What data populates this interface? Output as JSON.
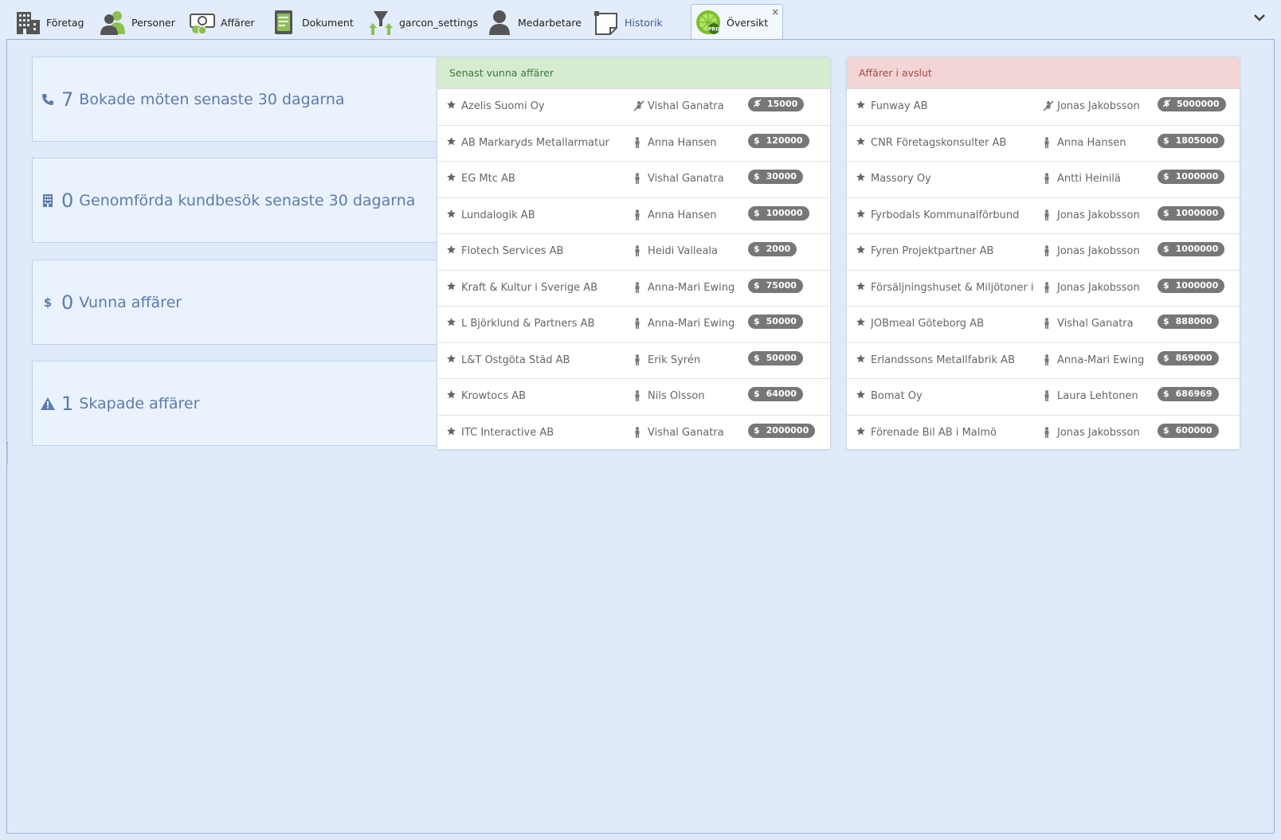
{
  "tabs": [
    {
      "label": "Företag",
      "icon": "building-icon"
    },
    {
      "label": "Personer",
      "icon": "people-icon"
    },
    {
      "label": "Affärer",
      "icon": "money-icon"
    },
    {
      "label": "Dokument",
      "icon": "document-icon"
    },
    {
      "label": "garcon_settings",
      "icon": "funnel-icon"
    },
    {
      "label": "Medarbetare",
      "icon": "person-icon"
    },
    {
      "label": "Historik",
      "icon": "note-icon"
    },
    {
      "label": "Översikt",
      "icon": "lime-pro-icon",
      "close": "×"
    }
  ],
  "stats": [
    {
      "count": "7",
      "text": "Bokade möten senaste 30 dagarna",
      "icon": "phone-icon"
    },
    {
      "count": "0",
      "text": "Genomförda kundbesök senaste 30 dagarna",
      "icon": "building-small-icon"
    },
    {
      "count": "0",
      "text": "Vunna affärer",
      "icon": "dollar-icon"
    },
    {
      "count": "1",
      "text": "Skapade affärer",
      "icon": "warning-icon"
    }
  ],
  "won": {
    "title": "Senast vunna affärer",
    "rows": [
      {
        "company": "Azelis Suomi Oy",
        "person": "Vishal Ganatra",
        "person_icon": "user-off-icon",
        "currency": "$",
        "value": "15000"
      },
      {
        "company": "AB Markaryds Metallarmatur",
        "person": "Anna Hansen",
        "person_icon": "person-icon",
        "currency": "$",
        "value": "120000"
      },
      {
        "company": "EG Mtc AB",
        "person": "Vishal Ganatra",
        "person_icon": "person-icon",
        "currency": "$",
        "value": "30000"
      },
      {
        "company": "Lundalogik AB",
        "person": "Anna Hansen",
        "person_icon": "person-icon",
        "currency": "$",
        "value": "100000"
      },
      {
        "company": "Flotech Services AB",
        "person": "Heidi Valleala",
        "person_icon": "person-icon",
        "currency": "$",
        "value": "2000"
      },
      {
        "company": "Kraft & Kultur i Sverige AB",
        "person": "Anna-Mari Ewing",
        "person_icon": "person-icon",
        "currency": "$",
        "value": "75000"
      },
      {
        "company": "L Björklund & Partners AB",
        "person": "Anna-Mari Ewing",
        "person_icon": "person-icon",
        "currency": "$",
        "value": "50000"
      },
      {
        "company": "L&T Östgöta Städ AB",
        "person": "Erik Syrén",
        "person_icon": "person-icon",
        "currency": "$",
        "value": "50000"
      },
      {
        "company": "Krowtocs AB",
        "person": "Nils Olsson",
        "person_icon": "person-icon",
        "currency": "$",
        "value": "64000"
      },
      {
        "company": "ITC Interactive AB",
        "person": "Vishal Ganatra",
        "person_icon": "person-icon",
        "currency": "$",
        "value": "2000000"
      }
    ]
  },
  "closing": {
    "title": "Affärer i avslut",
    "rows": [
      {
        "company": "Funway AB",
        "person": "Jonas Jakobsson",
        "person_icon": "user-off-icon",
        "currency": "$",
        "value": "5000000"
      },
      {
        "company": "CNR Företagskonsulter AB",
        "person": "Anna Hansen",
        "person_icon": "person-icon",
        "currency": "$",
        "value": "1805000"
      },
      {
        "company": "Massory Oy",
        "person": "Antti Heinilä",
        "person_icon": "person-icon",
        "currency": "$",
        "value": "1000000"
      },
      {
        "company": "Fyrbodals Kommunalförbund",
        "person": "Jonas Jakobsson",
        "person_icon": "person-icon",
        "currency": "$",
        "value": "1000000"
      },
      {
        "company": "Fyren Projektpartner AB",
        "person": "Jonas Jakobsson",
        "person_icon": "person-icon",
        "currency": "$",
        "value": "1000000"
      },
      {
        "company": "Försäljningshuset & Miljötoner i",
        "person": "Jonas Jakobsson",
        "person_icon": "person-icon",
        "currency": "$",
        "value": "1000000"
      },
      {
        "company": "JOBmeal Göteborg AB",
        "person": "Vishal Ganatra",
        "person_icon": "person-icon",
        "currency": "$",
        "value": "888000"
      },
      {
        "company": "Erlandssons Metallfabrik AB",
        "person": "Anna-Mari Ewing",
        "person_icon": "person-icon",
        "currency": "$",
        "value": "869000"
      },
      {
        "company": "Bomat Oy",
        "person": "Laura Lehtonen",
        "person_icon": "person-icon",
        "currency": "$",
        "value": "686969"
      },
      {
        "company": "Förenade Bil AB i Malmö",
        "person": "Jonas Jakobsson",
        "person_icon": "person-icon",
        "currency": "$",
        "value": "600000"
      }
    ]
  },
  "colors": {
    "won_header_bg": "#d6ecd0",
    "won_header_text": "#3c763d",
    "closing_header_bg": "#f2d6d6",
    "closing_header_text": "#a94442",
    "stat_text": "#5b7cad",
    "badge_bg": "#777777"
  }
}
